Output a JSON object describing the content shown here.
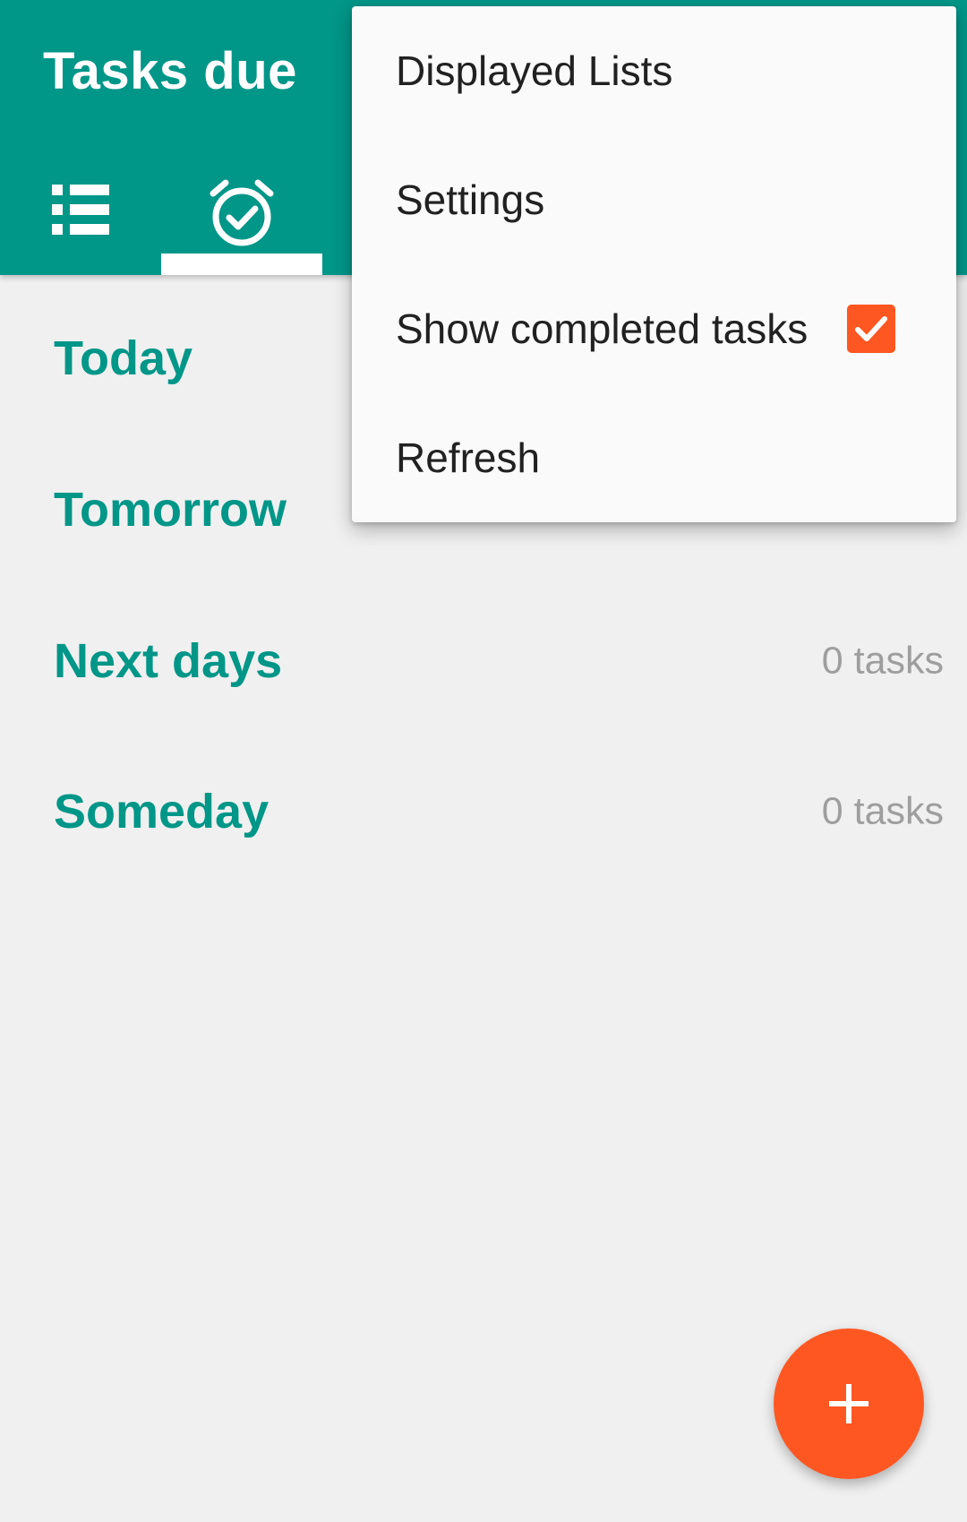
{
  "appbar": {
    "title": "Tasks due",
    "background_color": "#009688",
    "tabs": [
      {
        "icon": "list-icon",
        "selected": false
      },
      {
        "icon": "alarm-check-icon",
        "selected": true
      }
    ]
  },
  "sections": [
    {
      "label": "Today",
      "count": ""
    },
    {
      "label": "Tomorrow",
      "count": ""
    },
    {
      "label": "Next days",
      "count": "0 tasks"
    },
    {
      "label": "Someday",
      "count": "0 tasks"
    }
  ],
  "overflow_menu": {
    "items": [
      {
        "label": "Displayed Lists"
      },
      {
        "label": "Settings"
      },
      {
        "label": "Show completed tasks",
        "checked": true
      },
      {
        "label": "Refresh"
      }
    ]
  },
  "fab": {
    "icon": "plus-icon",
    "color": "#ff5722"
  },
  "colors": {
    "primary": "#009688",
    "accent": "#ff5722",
    "background": "#f0f0f0",
    "secondary_text": "#9e9e9e"
  }
}
